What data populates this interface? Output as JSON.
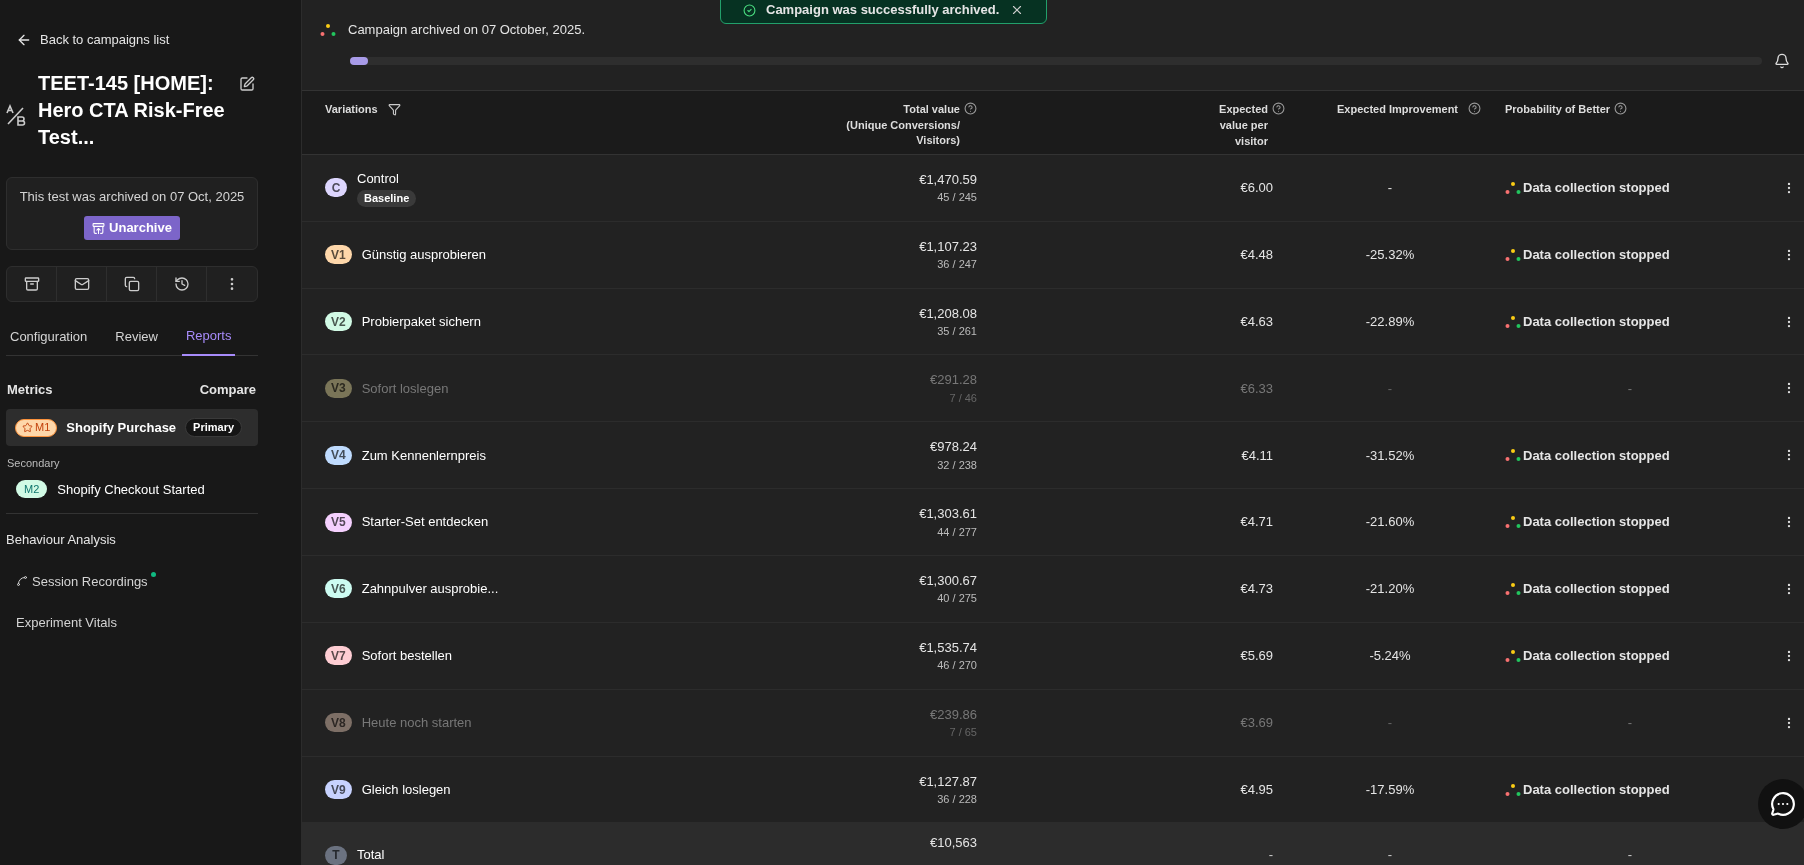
{
  "sidebar": {
    "back_link": "Back to campaigns list",
    "title": "TEET-145 [HOME]: Hero CTA Risk-Free Test...",
    "archive_notice": {
      "text": "This test was archived on 07 Oct, 2025",
      "button": "Unarchive"
    },
    "tabs": [
      {
        "label": "Configuration",
        "selected": false
      },
      {
        "label": "Review",
        "selected": false
      },
      {
        "label": "Reports",
        "selected": true
      }
    ],
    "metrics": {
      "heading": "Metrics",
      "compare": "Compare",
      "primary": {
        "badge": "M1",
        "name": "Shopify Purchase",
        "tag": "Primary"
      },
      "secondary_heading": "Secondary",
      "secondary": [
        {
          "badge": "M2",
          "name": "Shopify Checkout Started"
        }
      ]
    },
    "behaviour": {
      "heading": "Behaviour Analysis",
      "items": [
        {
          "label": "Session Recordings",
          "kind": "recordings",
          "live": true
        },
        {
          "label": "Experiment Vitals",
          "kind": "plain",
          "live": false
        }
      ]
    }
  },
  "header": {
    "message": "Campaign archived on 07 October, 2025.",
    "progress": {
      "level": 0.012
    }
  },
  "toast": {
    "message": "Campaign was successfully archived."
  },
  "table": {
    "columns": [
      {
        "label": "Variations",
        "kind": "filter"
      },
      {
        "label": "Total value",
        "sub": "(Unique Conversions/ Visitors)",
        "kind": "help"
      },
      {
        "label": "Expected value per visitor",
        "kind": "help"
      },
      {
        "label": "Expected Improvement",
        "kind": "help"
      },
      {
        "label": "Probability of Better",
        "kind": "help"
      }
    ],
    "rows": [
      {
        "badge": "C",
        "color": "#ddd6fe",
        "name": "Control",
        "tag": "Baseline",
        "total": "€1,470.59",
        "conversions": "45 / 245",
        "ev": "€6.00",
        "improvement": "-",
        "probability": "Data collection stopped",
        "disabled": false
      },
      {
        "badge": "V1",
        "color": "#fed7aa",
        "name": "Günstig ausprobieren",
        "total": "€1,107.23",
        "conversions": "36 / 247",
        "ev": "€4.48",
        "improvement": "-25.32%",
        "probability": "Data collection stopped",
        "disabled": false
      },
      {
        "badge": "V2",
        "color": "#d1fae5",
        "name": "Probierpaket sichern",
        "total": "€1,208.08",
        "conversions": "35 / 261",
        "ev": "€4.63",
        "improvement": "-22.89%",
        "probability": "Data collection stopped",
        "disabled": false
      },
      {
        "badge": "V3",
        "color": "#7a7558",
        "name": "Sofort loslegen",
        "total": "€291.28",
        "conversions": "7 / 46",
        "ev": "€6.33",
        "improvement": "-",
        "probability": "-",
        "disabled": true
      },
      {
        "badge": "V4",
        "color": "#bfdbfe",
        "name": "Zum Kennenlernpreis",
        "total": "€978.24",
        "conversions": "32 / 238",
        "ev": "€4.11",
        "improvement": "-31.52%",
        "probability": "Data collection stopped",
        "disabled": false
      },
      {
        "badge": "V5",
        "color": "#f5d0fe",
        "name": "Starter-Set entdecken",
        "total": "€1,303.61",
        "conversions": "44 / 277",
        "ev": "€4.71",
        "improvement": "-21.60%",
        "probability": "Data collection stopped",
        "disabled": false
      },
      {
        "badge": "V6",
        "color": "#ccfbf1",
        "name": "Zahnpulver ausprobie...",
        "total": "€1,300.67",
        "conversions": "40 / 275",
        "ev": "€4.73",
        "improvement": "-21.20%",
        "probability": "Data collection stopped",
        "disabled": false
      },
      {
        "badge": "V7",
        "color": "#fecdd3",
        "name": "Sofort bestellen",
        "total": "€1,535.74",
        "conversions": "46 / 270",
        "ev": "€5.69",
        "improvement": "-5.24%",
        "probability": "Data collection stopped",
        "disabled": false
      },
      {
        "badge": "V8",
        "color": "#7d6f66",
        "name": "Heute noch starten",
        "total": "€239.86",
        "conversions": "7 / 65",
        "ev": "€3.69",
        "improvement": "-",
        "probability": "-",
        "disabled": true
      },
      {
        "badge": "V9",
        "color": "#c7d2fe",
        "name": "Gleich loslegen",
        "total": "€1,127.87",
        "conversions": "36 / 228",
        "ev": "€4.95",
        "improvement": "-17.59%",
        "probability": "Data collection stopped",
        "disabled": false
      }
    ],
    "total_row": {
      "badge": "T",
      "color": "#6b7280",
      "name": "Total",
      "total": "€10,563",
      "ev": "-",
      "improvement": "-",
      "probability": "-"
    }
  }
}
